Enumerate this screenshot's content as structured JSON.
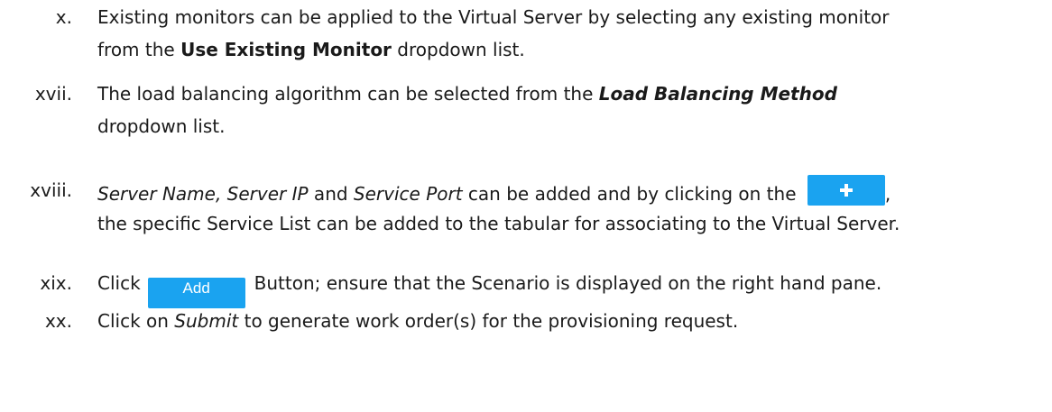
{
  "document": {
    "steps": [
      {
        "number": "x.",
        "line1": {
          "text": "Existing monitors can be applied to the Virtual Server by selecting any existing monitor"
        },
        "line2": {
          "before": "from the ",
          "bold": "Use Existing Monitor",
          "after": " dropdown list."
        }
      },
      {
        "number": "xvii.",
        "line1": {
          "before": "The load balancing algorithm can be selected from the ",
          "bold_italic": "Load Balancing Method"
        },
        "line2": {
          "text": "dropdown list."
        }
      },
      {
        "number": "xviii.",
        "line1": {
          "italic1": "Server Name, Server IP",
          "mid1": " and ",
          "italic2": "Service Port",
          "mid2": " can be added and by clicking on the ",
          "after": ","
        },
        "line2": {
          "text": "the specific Service List can be added to the tabular for associating to the Virtual Server."
        }
      },
      {
        "number": "xix.",
        "line1": {
          "before": "Click",
          "button_label": "Add",
          "after": "Button; ensure that the Scenario is displayed on the right hand pane."
        }
      },
      {
        "number": "xx.",
        "line1": {
          "before": "Click on ",
          "italic": "Submit",
          "after": " to generate work order(s) for the provisioning request."
        }
      }
    ]
  },
  "icons": {
    "plus_button_icon": "plus-icon"
  },
  "colors": {
    "button_blue": "#1aa3f0",
    "text": "#1a1a1a"
  }
}
